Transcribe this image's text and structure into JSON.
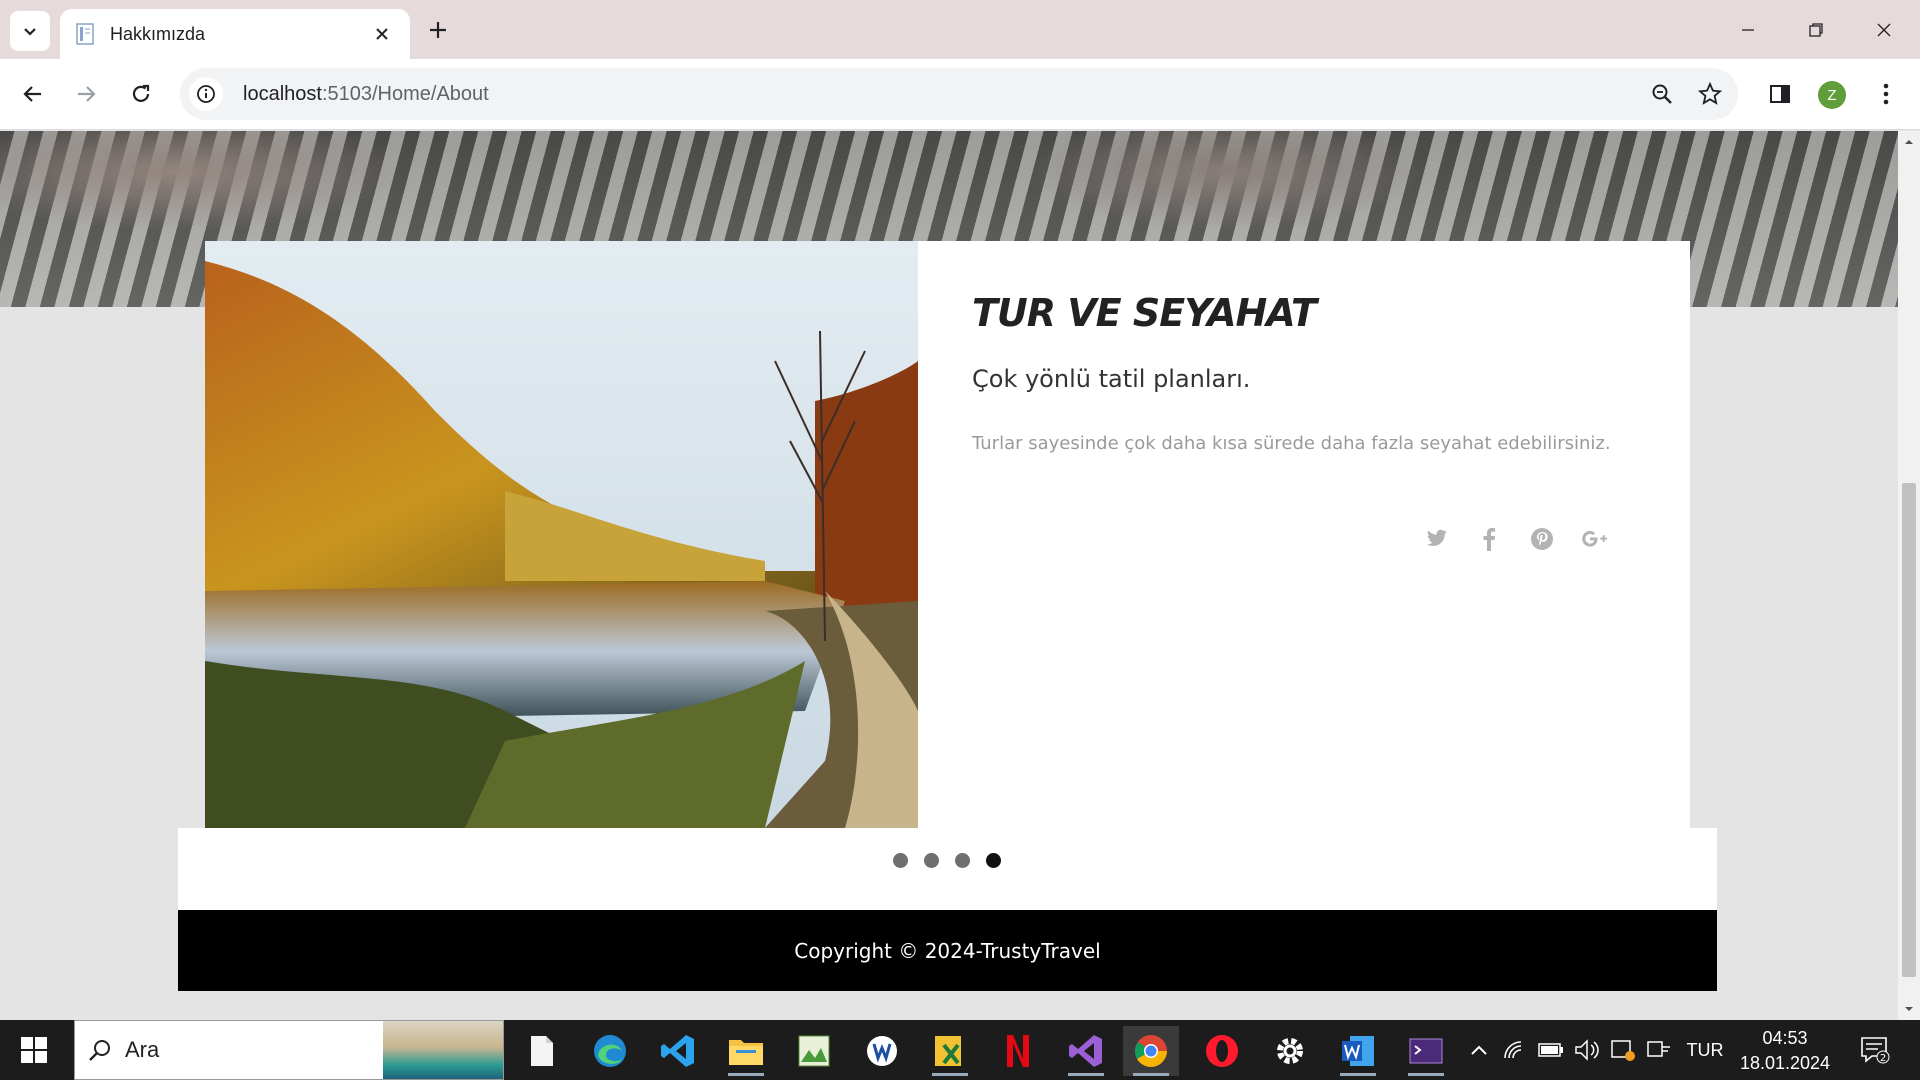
{
  "browser": {
    "tab_title": "Hakkımızda",
    "url_host": "localhost",
    "url_path": ":5103/Home/About",
    "profile_initial": "Z"
  },
  "page": {
    "card_title": "TUR VE SEYAHAT",
    "card_subtitle": "Çok yönlü tatil planları.",
    "card_description": "Turlar sayesinde çok daha kısa sürede daha fazla seyahat edebilirsiniz.",
    "social_icons": [
      "twitter-icon",
      "facebook-icon",
      "pinterest-icon",
      "google-plus-icon"
    ],
    "carousel": {
      "total": 4,
      "active_index": 3
    },
    "footer": "Copyright © 2024-TrustyTravel"
  },
  "taskbar": {
    "search_placeholder": "Ara",
    "language": "TUR",
    "time": "04:53",
    "date": "18.01.2024",
    "notification_count": "2",
    "apps": [
      "file-explorer-icon",
      "edge-icon",
      "vscode-icon",
      "folder-icon",
      "notepad-icon",
      "app-icon",
      "excel-icon",
      "netflix-icon",
      "visual-studio-icon",
      "chrome-icon",
      "opera-icon",
      "settings-icon",
      "word-icon",
      "terminal-icon"
    ]
  },
  "colors": {
    "accent_green": "#5f9e3a",
    "footer_bg": "#000000",
    "active_dot": "#111111"
  }
}
